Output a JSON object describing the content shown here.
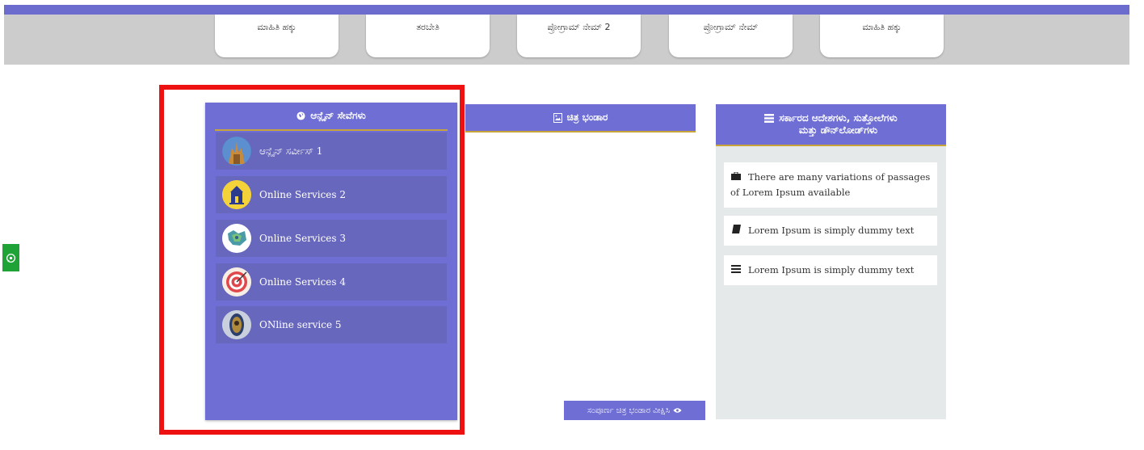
{
  "nav": {
    "tabs": [
      {
        "label": "ಮಾಹಿತಿ ಹಕ್ಕು"
      },
      {
        "label": "ತರಬೇತಿ"
      },
      {
        "label": "ಪ್ರೋಗ್ರಾಮ್ ನೇಮ್ 2"
      },
      {
        "label": "ಪ್ರೋಗ್ರಾಮ್ ನೇಮ್"
      },
      {
        "label": "ಮಾಹಿತಿ ಹಕ್ಕು"
      }
    ]
  },
  "services": {
    "title": "ಆನ್ಲೈನ್ ಸೇವೆಗಳು",
    "title_icon": "globe-icon",
    "items": [
      {
        "label": "ಆನ್ಲೈನ್ ಸರ್ವೀಸ್ 1",
        "icon": "temple-icon"
      },
      {
        "label": "Online Services 2",
        "icon": "building-icon"
      },
      {
        "label": "Online Services 3",
        "icon": "map-icon"
      },
      {
        "label": "Online Services 4",
        "icon": "target-icon"
      },
      {
        "label": "ONline service 5",
        "icon": "shrine-icon"
      }
    ]
  },
  "gallery": {
    "title": "ಚಿತ್ರ ಭಂಡಾರ",
    "title_icon": "image-file-icon",
    "view_all_label": "ಸಂಪೂರ್ಣ ಚಿತ್ರ ಭಂಡಾರ ವೀಕ್ಷಿಸಿ",
    "view_all_icon": "eye-icon"
  },
  "orders": {
    "title_line1": "ಸರ್ಕಾರದ ಆದೇಶಗಳು, ಸುತ್ತೋಲೆಗಳು",
    "title_line2": "ಮತ್ತು ಡೌನ್‌ಲೋಡ್‌ಗಳು",
    "title_icon": "list-icon",
    "items": [
      {
        "text": "There are many variations of passages of Lorem Ipsum available",
        "icon": "briefcase-icon"
      },
      {
        "text": "Lorem Ipsum is simply dummy text",
        "icon": "book-icon"
      },
      {
        "text": "Lorem Ipsum is simply dummy text",
        "icon": "list-icon"
      }
    ]
  },
  "colors": {
    "accent": "#6e6ed4",
    "underline": "#c9a43a",
    "whatsapp": "#1fa336",
    "highlight": "#ee1111"
  }
}
